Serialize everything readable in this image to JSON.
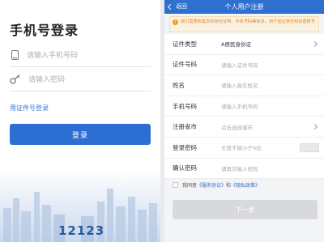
{
  "login": {
    "title": "手机号登录",
    "phone_placeholder": "请输入手机号码",
    "password_placeholder": "请输入密码",
    "cert_login_link": "用证件号登录",
    "login_button": "登录",
    "brand_text": "12123",
    "icons": {
      "phone": "phone-icon",
      "key": "key-icon"
    },
    "colors": {
      "primary": "#2c6ed1",
      "link": "#3a78d0",
      "brand": "#2a5a9a"
    }
  },
  "register": {
    "back_label": "返回",
    "title": "个人用户注册",
    "notice": "我们需要收集您的身份证明、手机号码等信息，用于验证身份和创建账号",
    "fields": [
      {
        "label": "证件类型",
        "value": "A居民身份证",
        "has_arrow": true
      },
      {
        "label": "证件号码",
        "value": "请输入证件号码"
      },
      {
        "label": "姓名",
        "value": "请输入真实姓名"
      },
      {
        "label": "手机号码",
        "value": "请输入手机号码"
      },
      {
        "label": "注册省市",
        "value": "点击选择城市",
        "has_arrow": true
      },
      {
        "label": "登录密码",
        "value": "长度不能小于6位"
      },
      {
        "label": "确认密码",
        "value": "请再次输入密码"
      }
    ],
    "agree_prefix": "我同意",
    "agree_link1": "《服务协议》",
    "agree_and": "和",
    "agree_link2": "《隐私政策》",
    "next_button": "下一步",
    "colors": {
      "topbar": "#2f6fd0",
      "notice_text": "#e08a2a",
      "disabled_button": "#d8d9dc"
    }
  }
}
